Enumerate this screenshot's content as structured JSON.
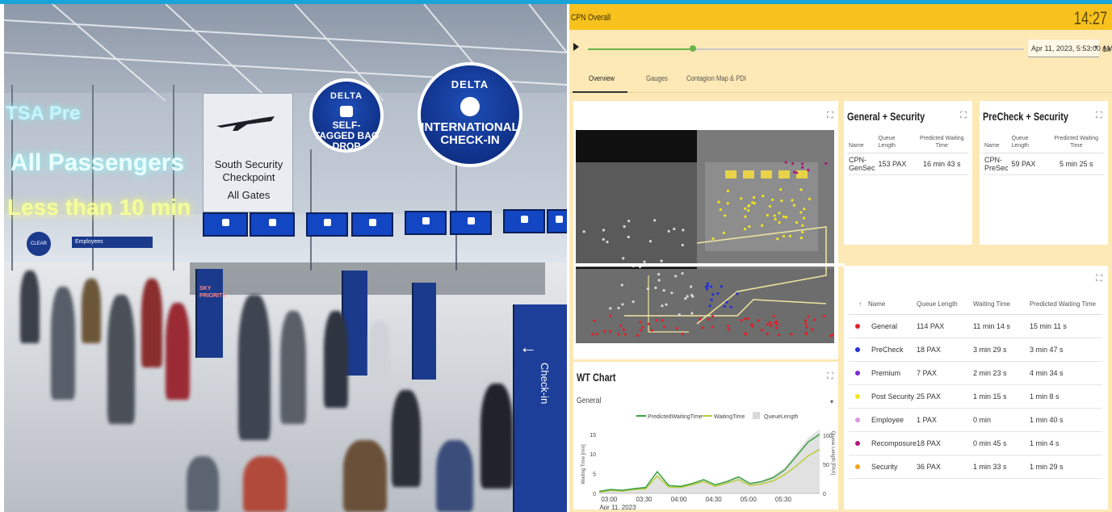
{
  "photo": {
    "tsa_pre": "TSA Pre",
    "clear": "CLEAR",
    "all_passengers": "All Passengers",
    "less_than": "Less than 10 min",
    "checkpoint_title": "South Security Checkpoint",
    "checkpoint_sub": "All Gates",
    "delta_brand": "DELTA",
    "bag_drop": "SELF-TAGGED BAG DROP",
    "intl_checkin": "INTERNATIONAL CHECK-IN",
    "sky_priority": "SKY PRIORITY",
    "checkin": "Check-in",
    "employees": "Employees"
  },
  "header": {
    "title": "CPN Overall",
    "time": "14:27",
    "accent": "#f7c21d"
  },
  "playbar": {
    "date": "Apr 11, 2023, 5:53:00 AM",
    "speed": "1x",
    "progress": 0.24
  },
  "tabs": [
    {
      "label": "Overview",
      "active": true
    },
    {
      "label": "Gauges",
      "active": false
    },
    {
      "label": "Contagion Map & PDI",
      "active": false
    }
  ],
  "general_security": {
    "title": "General + Security",
    "headers": [
      "Name",
      "Queue Length",
      "Predicted Waiting Time"
    ],
    "rows": [
      {
        "name": "CPN-GenSec",
        "queue": "153 PAX",
        "wait": "16 min 43 s"
      }
    ]
  },
  "precheck_security": {
    "title": "PreCheck + Security",
    "headers": [
      "Name",
      "Queue Length",
      "Predicted Waiting Time"
    ],
    "rows": [
      {
        "name": "CPN-PreSec",
        "queue": "59 PAX",
        "wait": "5 min 25 s"
      }
    ]
  },
  "queues": {
    "sort_icon": "arrow-up-icon",
    "headers": [
      "Name",
      "Queue Length",
      "Waiting Time",
      "Predicted Waiting Time"
    ],
    "rows": [
      {
        "color": "#e0202a",
        "name": "General",
        "queue": "114 PAX",
        "wait": "11 min 14 s",
        "pred": "15 min 11 s"
      },
      {
        "color": "#2430d8",
        "name": "PreCheck",
        "queue": "18 PAX",
        "wait": "3 min 29 s",
        "pred": "3 min 47 s"
      },
      {
        "color": "#7a2ad0",
        "name": "Premium",
        "queue": "7 PAX",
        "wait": "2 min 23 s",
        "pred": "4 min 34 s"
      },
      {
        "color": "#f1e51a",
        "name": "Post Security",
        "queue": "25 PAX",
        "wait": "1 min 15 s",
        "pred": "1 min 8 s"
      },
      {
        "color": "#d79adc",
        "name": "Employee",
        "queue": "1 PAX",
        "wait": "0 min",
        "pred": "1 min 40 s"
      },
      {
        "color": "#b0157a",
        "name": "Recomposure",
        "queue": "18 PAX",
        "wait": "0 min 45 s",
        "pred": "1 min 4 s"
      },
      {
        "color": "#f3a21a",
        "name": "Security",
        "queue": "36 PAX",
        "wait": "1 min 33 s",
        "pred": "1 min 29 s"
      }
    ]
  },
  "wt_chart": {
    "title": "WT Chart",
    "selected": "General",
    "legend": [
      "PredictedWaitingTime",
      "WaitingTime",
      "QueueLength"
    ],
    "colors": {
      "pred": "#3aa040",
      "wait": "#b8cc3a",
      "queue": "#d9d9d9"
    },
    "ylabel_left": "Waiting Time [min]",
    "ylabel_right": "Queue Length [PAX]",
    "x_ticks": [
      "03:00",
      "03:30",
      "04:00",
      "04:30",
      "05:00",
      "05:30"
    ],
    "x_date": "Apr 11, 2023",
    "y_ticks_left": [
      "0",
      "5",
      "10",
      "15"
    ],
    "y_ticks_right": [
      "0",
      "50",
      "100"
    ]
  },
  "chart_data": {
    "type": "line",
    "title": "WT Chart",
    "subtitle": "General",
    "xlabel": "",
    "ylabel": "Waiting Time [min]",
    "ylabel_right": "Queue Length [PAX]",
    "x": [
      "02:50",
      "03:00",
      "03:10",
      "03:20",
      "03:30",
      "03:40",
      "03:50",
      "04:00",
      "04:10",
      "04:20",
      "04:30",
      "04:40",
      "04:50",
      "05:00",
      "05:10",
      "05:20",
      "05:30",
      "05:40",
      "05:50",
      "05:53"
    ],
    "ylim": [
      0,
      17
    ],
    "ylim_right": [
      0,
      115
    ],
    "series": [
      {
        "name": "PredictedWaitingTime",
        "axis": "left",
        "values": [
          0.5,
          1.0,
          0.8,
          1.2,
          1.5,
          5.5,
          2.0,
          1.8,
          2.5,
          3.5,
          2.2,
          3.0,
          4.2,
          2.5,
          3.0,
          4.0,
          6.0,
          9.5,
          13.0,
          15.0
        ]
      },
      {
        "name": "WaitingTime",
        "axis": "left",
        "values": [
          0.3,
          0.8,
          0.6,
          1.0,
          1.2,
          4.5,
          1.6,
          1.5,
          2.2,
          3.0,
          1.8,
          2.6,
          3.5,
          2.0,
          2.4,
          3.2,
          4.8,
          7.0,
          9.5,
          11.2
        ]
      },
      {
        "name": "QueueLength",
        "axis": "right",
        "values": [
          5,
          8,
          6,
          9,
          12,
          30,
          14,
          12,
          18,
          24,
          15,
          20,
          28,
          18,
          22,
          30,
          45,
          70,
          95,
          110
        ]
      }
    ]
  }
}
